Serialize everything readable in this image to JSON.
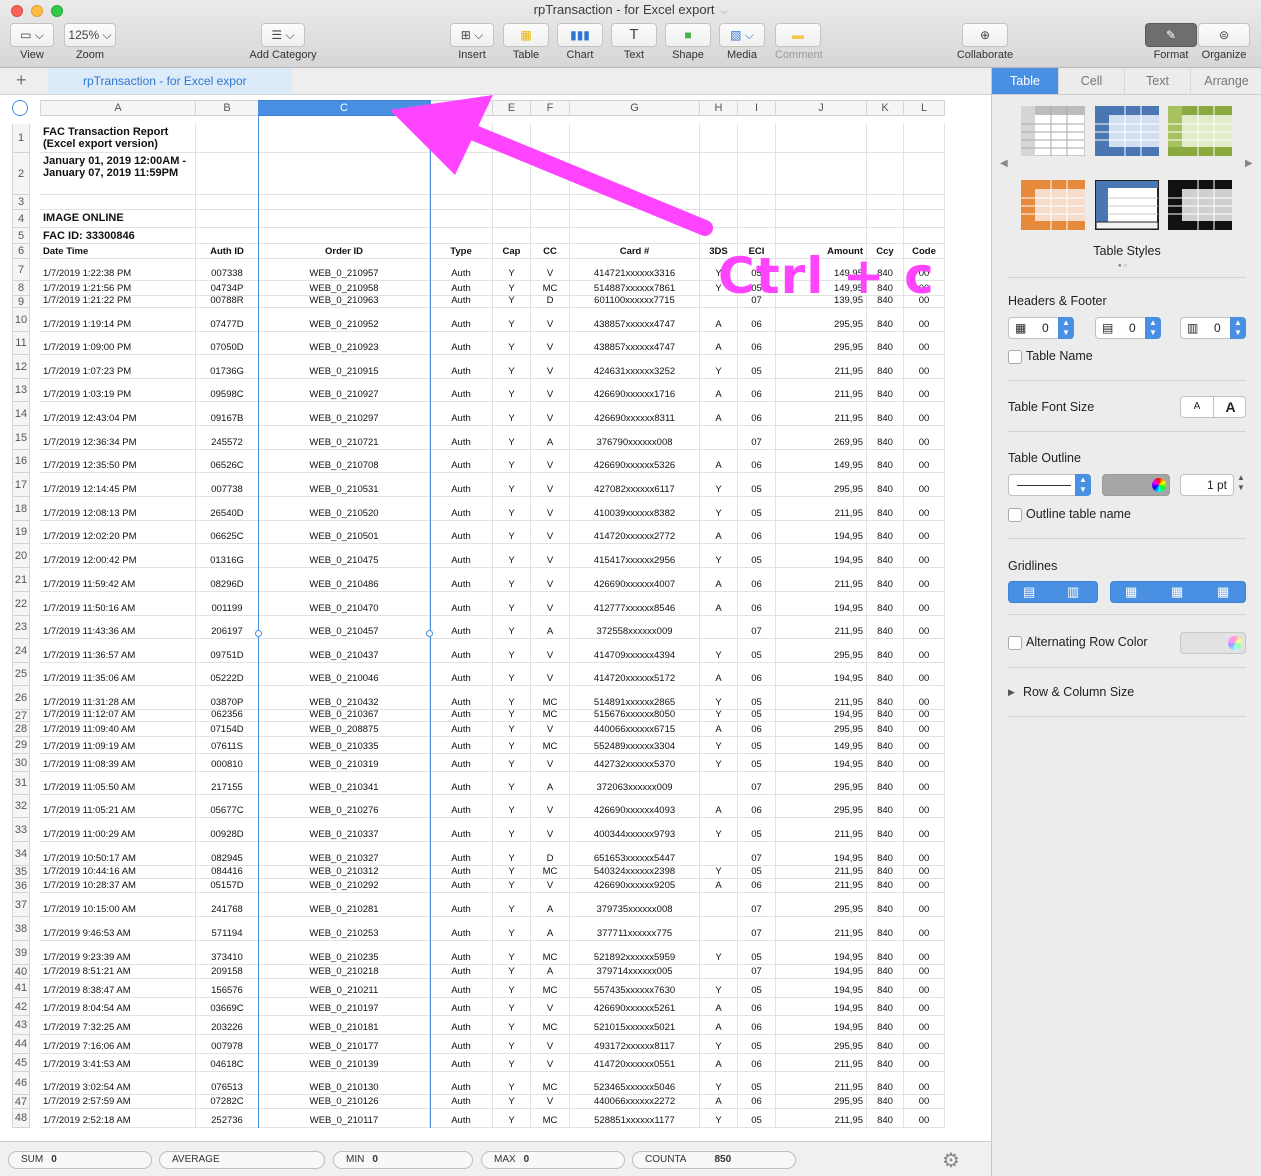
{
  "window": {
    "title": "rpTransaction - for Excel export"
  },
  "toolbar": {
    "view": "View",
    "zoom_value": "125%",
    "zoom": "Zoom",
    "add_category": "Add Category",
    "insert": "Insert",
    "table": "Table",
    "chart": "Chart",
    "text": "Text",
    "shape": "Shape",
    "media": "Media",
    "comment": "Comment",
    "collaborate": "Collaborate",
    "format": "Format",
    "organize": "Organize"
  },
  "sheet": {
    "tab_label": "rpTransaction - for Excel expor",
    "add": "+"
  },
  "columns": [
    "A",
    "B",
    "C",
    "D",
    "E",
    "F",
    "G",
    "H",
    "I",
    "J",
    "K",
    "L"
  ],
  "title_rows": [
    {
      "num": "1",
      "text": "FAC Transaction Report (Excel export version)"
    },
    {
      "num": "2",
      "text": "January 01, 2019 12:00AM - January 07, 2019 11:59PM"
    },
    {
      "num": "3",
      "text": ""
    },
    {
      "num": "4",
      "text": "IMAGE ONLINE"
    },
    {
      "num": "5",
      "text": "FAC ID: 33300846"
    }
  ],
  "header_row": {
    "num": "6",
    "cells": [
      "Date Time",
      "Auth ID",
      "Order ID",
      "Type",
      "Cap",
      "CC",
      "Card #",
      "3DS",
      "ECI",
      "Amount",
      "Ccy",
      "Code"
    ]
  },
  "rows": [
    {
      "num": "7",
      "c": [
        "1/7/2019 1:22:38 PM",
        "007338",
        "WEB_0_210957",
        "Auth",
        "Y",
        "V",
        "414721xxxxxx3316",
        "Y",
        "05",
        "149,95",
        "840",
        "00"
      ]
    },
    {
      "num": "8",
      "c": [
        "1/7/2019 1:21:56 PM",
        "04734P",
        "WEB_0_210958",
        "Auth",
        "Y",
        "MC",
        "514887xxxxxx7861",
        "Y",
        "05",
        "149,95",
        "840",
        "00"
      ]
    },
    {
      "num": "9",
      "c": [
        "1/7/2019 1:21:22 PM",
        "00788R",
        "WEB_0_210963",
        "Auth",
        "Y",
        "D",
        "601100xxxxxx7715",
        "",
        "07",
        "139,95",
        "840",
        "00"
      ]
    },
    {
      "num": "10",
      "c": [
        "1/7/2019 1:19:14 PM",
        "07477D",
        "WEB_0_210952",
        "Auth",
        "Y",
        "V",
        "438857xxxxxx4747",
        "A",
        "06",
        "295,95",
        "840",
        "00"
      ]
    },
    {
      "num": "11",
      "c": [
        "1/7/2019 1:09:00 PM",
        "07050D",
        "WEB_0_210923",
        "Auth",
        "Y",
        "V",
        "438857xxxxxx4747",
        "A",
        "06",
        "295,95",
        "840",
        "00"
      ]
    },
    {
      "num": "12",
      "c": [
        "1/7/2019 1:07:23 PM",
        "01736G",
        "WEB_0_210915",
        "Auth",
        "Y",
        "V",
        "424631xxxxxx3252",
        "Y",
        "05",
        "211,95",
        "840",
        "00"
      ]
    },
    {
      "num": "13",
      "c": [
        "1/7/2019 1:03:19 PM",
        "09598C",
        "WEB_0_210927",
        "Auth",
        "Y",
        "V",
        "426690xxxxxx1716",
        "A",
        "06",
        "211,95",
        "840",
        "00"
      ]
    },
    {
      "num": "14",
      "c": [
        "1/7/2019 12:43:04 PM",
        "09167B",
        "WEB_0_210297",
        "Auth",
        "Y",
        "V",
        "426690xxxxxx8311",
        "A",
        "06",
        "211,95",
        "840",
        "00"
      ]
    },
    {
      "num": "15",
      "c": [
        "1/7/2019 12:36:34 PM",
        "245572",
        "WEB_0_210721",
        "Auth",
        "Y",
        "A",
        "376790xxxxxx008",
        "",
        "07",
        "269,95",
        "840",
        "00"
      ]
    },
    {
      "num": "16",
      "c": [
        "1/7/2019 12:35:50 PM",
        "06526C",
        "WEB_0_210708",
        "Auth",
        "Y",
        "V",
        "426690xxxxxx5326",
        "A",
        "06",
        "149,95",
        "840",
        "00"
      ]
    },
    {
      "num": "17",
      "c": [
        "1/7/2019 12:14:45 PM",
        "007738",
        "WEB_0_210531",
        "Auth",
        "Y",
        "V",
        "427082xxxxxx6117",
        "Y",
        "05",
        "295,95",
        "840",
        "00"
      ]
    },
    {
      "num": "18",
      "c": [
        "1/7/2019 12:08:13 PM",
        "26540D",
        "WEB_0_210520",
        "Auth",
        "Y",
        "V",
        "410039xxxxxx8382",
        "Y",
        "05",
        "211,95",
        "840",
        "00"
      ]
    },
    {
      "num": "19",
      "c": [
        "1/7/2019 12:02:20 PM",
        "06625C",
        "WEB_0_210501",
        "Auth",
        "Y",
        "V",
        "414720xxxxxx2772",
        "A",
        "06",
        "194,95",
        "840",
        "00"
      ]
    },
    {
      "num": "20",
      "c": [
        "1/7/2019 12:00:42 PM",
        "01316G",
        "WEB_0_210475",
        "Auth",
        "Y",
        "V",
        "415417xxxxxx2956",
        "Y",
        "05",
        "194,95",
        "840",
        "00"
      ]
    },
    {
      "num": "21",
      "c": [
        "1/7/2019 11:59:42 AM",
        "08296D",
        "WEB_0_210486",
        "Auth",
        "Y",
        "V",
        "426690xxxxxx4007",
        "A",
        "06",
        "211,95",
        "840",
        "00"
      ]
    },
    {
      "num": "22",
      "c": [
        "1/7/2019 11:50:16 AM",
        "001199",
        "WEB_0_210470",
        "Auth",
        "Y",
        "V",
        "412777xxxxxx8546",
        "A",
        "06",
        "194,95",
        "840",
        "00"
      ]
    },
    {
      "num": "23",
      "c": [
        "1/7/2019 11:43:36 AM",
        "206197",
        "WEB_0_210457",
        "Auth",
        "Y",
        "A",
        "372558xxxxxx009",
        "",
        "07",
        "211,95",
        "840",
        "00"
      ]
    },
    {
      "num": "24",
      "c": [
        "1/7/2019 11:36:57 AM",
        "09751D",
        "WEB_0_210437",
        "Auth",
        "Y",
        "V",
        "414709xxxxxx4394",
        "Y",
        "05",
        "295,95",
        "840",
        "00"
      ]
    },
    {
      "num": "25",
      "c": [
        "1/7/2019 11:35:06 AM",
        "05222D",
        "WEB_0_210046",
        "Auth",
        "Y",
        "V",
        "414720xxxxxx5172",
        "A",
        "06",
        "194,95",
        "840",
        "00"
      ]
    },
    {
      "num": "26",
      "c": [
        "1/7/2019 11:31:28 AM",
        "03870P",
        "WEB_0_210432",
        "Auth",
        "Y",
        "MC",
        "514891xxxxxx2865",
        "Y",
        "05",
        "211,95",
        "840",
        "00"
      ]
    },
    {
      "num": "27",
      "c": [
        "1/7/2019 11:12:07 AM",
        "062356",
        "WEB_0_210367",
        "Auth",
        "Y",
        "MC",
        "515676xxxxxx8050",
        "Y",
        "05",
        "194,95",
        "840",
        "00"
      ]
    },
    {
      "num": "28",
      "c": [
        "1/7/2019 11:09:40 AM",
        "07154D",
        "WEB_0_208875",
        "Auth",
        "Y",
        "V",
        "440066xxxxxx6715",
        "A",
        "06",
        "295,95",
        "840",
        "00"
      ]
    },
    {
      "num": "29",
      "c": [
        "1/7/2019 11:09:19 AM",
        "07611S",
        "WEB_0_210335",
        "Auth",
        "Y",
        "MC",
        "552489xxxxxx3304",
        "Y",
        "05",
        "149,95",
        "840",
        "00"
      ]
    },
    {
      "num": "30",
      "c": [
        "1/7/2019 11:08:39 AM",
        "000810",
        "WEB_0_210319",
        "Auth",
        "Y",
        "V",
        "442732xxxxxx5370",
        "Y",
        "05",
        "194,95",
        "840",
        "00"
      ]
    },
    {
      "num": "31",
      "c": [
        "1/7/2019 11:05:50 AM",
        "217155",
        "WEB_0_210341",
        "Auth",
        "Y",
        "A",
        "372063xxxxxx009",
        "",
        "07",
        "295,95",
        "840",
        "00"
      ]
    },
    {
      "num": "32",
      "c": [
        "1/7/2019 11:05:21 AM",
        "05677C",
        "WEB_0_210276",
        "Auth",
        "Y",
        "V",
        "426690xxxxxx4093",
        "A",
        "06",
        "295,95",
        "840",
        "00"
      ]
    },
    {
      "num": "33",
      "c": [
        "1/7/2019 11:00:29 AM",
        "00928D",
        "WEB_0_210337",
        "Auth",
        "Y",
        "V",
        "400344xxxxxx9793",
        "Y",
        "05",
        "211,95",
        "840",
        "00"
      ]
    },
    {
      "num": "34",
      "c": [
        "1/7/2019 10:50:17 AM",
        "082945",
        "WEB_0_210327",
        "Auth",
        "Y",
        "D",
        "651653xxxxxx5447",
        "",
        "07",
        "194,95",
        "840",
        "00"
      ]
    },
    {
      "num": "35",
      "c": [
        "1/7/2019 10:44:16 AM",
        "084416",
        "WEB_0_210312",
        "Auth",
        "Y",
        "MC",
        "540324xxxxxx2398",
        "Y",
        "05",
        "211,95",
        "840",
        "00"
      ]
    },
    {
      "num": "36",
      "c": [
        "1/7/2019 10:28:37 AM",
        "05157D",
        "WEB_0_210292",
        "Auth",
        "Y",
        "V",
        "426690xxxxxx9205",
        "A",
        "06",
        "211,95",
        "840",
        "00"
      ]
    },
    {
      "num": "37",
      "c": [
        "1/7/2019 10:15:00 AM",
        "241768",
        "WEB_0_210281",
        "Auth",
        "Y",
        "A",
        "379735xxxxxx008",
        "",
        "07",
        "295,95",
        "840",
        "00"
      ]
    },
    {
      "num": "38",
      "c": [
        "1/7/2019 9:46:53 AM",
        "571194",
        "WEB_0_210253",
        "Auth",
        "Y",
        "A",
        "377711xxxxxx775",
        "",
        "07",
        "211,95",
        "840",
        "00"
      ]
    },
    {
      "num": "39",
      "c": [
        "1/7/2019 9:23:39 AM",
        "373410",
        "WEB_0_210235",
        "Auth",
        "Y",
        "MC",
        "521892xxxxxx5959",
        "Y",
        "05",
        "194,95",
        "840",
        "00"
      ]
    },
    {
      "num": "40",
      "c": [
        "1/7/2019 8:51:21 AM",
        "209158",
        "WEB_0_210218",
        "Auth",
        "Y",
        "A",
        "379714xxxxxx005",
        "",
        "07",
        "194,95",
        "840",
        "00"
      ]
    },
    {
      "num": "41",
      "c": [
        "1/7/2019 8:38:47 AM",
        "156576",
        "WEB_0_210211",
        "Auth",
        "Y",
        "MC",
        "557435xxxxxx7630",
        "Y",
        "05",
        "194,95",
        "840",
        "00"
      ]
    },
    {
      "num": "42",
      "c": [
        "1/7/2019 8:04:54 AM",
        "03669C",
        "WEB_0_210197",
        "Auth",
        "Y",
        "V",
        "426690xxxxxx5261",
        "A",
        "06",
        "194,95",
        "840",
        "00"
      ]
    },
    {
      "num": "43",
      "c": [
        "1/7/2019 7:32:25 AM",
        "203226",
        "WEB_0_210181",
        "Auth",
        "Y",
        "MC",
        "521015xxxxxx5021",
        "A",
        "06",
        "194,95",
        "840",
        "00"
      ]
    },
    {
      "num": "44",
      "c": [
        "1/7/2019 7:16:06 AM",
        "007978",
        "WEB_0_210177",
        "Auth",
        "Y",
        "V",
        "493172xxxxxx8117",
        "Y",
        "05",
        "295,95",
        "840",
        "00"
      ]
    },
    {
      "num": "45",
      "c": [
        "1/7/2019 3:41:53 AM",
        "04618C",
        "WEB_0_210139",
        "Auth",
        "Y",
        "V",
        "414720xxxxxx0551",
        "A",
        "06",
        "211,95",
        "840",
        "00"
      ]
    },
    {
      "num": "46",
      "c": [
        "1/7/2019 3:02:54 AM",
        "076513",
        "WEB_0_210130",
        "Auth",
        "Y",
        "MC",
        "523465xxxxxx5046",
        "Y",
        "05",
        "211,95",
        "840",
        "00"
      ]
    },
    {
      "num": "47",
      "c": [
        "1/7/2019 2:57:59 AM",
        "07282C",
        "WEB_0_210126",
        "Auth",
        "Y",
        "V",
        "440066xxxxxx2272",
        "A",
        "06",
        "295,95",
        "840",
        "00"
      ]
    },
    {
      "num": "48",
      "c": [
        "1/7/2019 2:52:18 AM",
        "252736",
        "WEB_0_210117",
        "Auth",
        "Y",
        "MC",
        "528851xxxxxx1177",
        "Y",
        "05",
        "211,95",
        "840",
        "00"
      ]
    }
  ],
  "annotation": {
    "text": "Ctrl + c",
    "color": "#ff44ff"
  },
  "status": {
    "sum_label": "SUM",
    "sum_value": "0",
    "average_label": "AVERAGE",
    "min_label": "MIN",
    "min_value": "0",
    "max_label": "MAX",
    "max_value": "0",
    "counta_label": "COUNTA",
    "counta_value": "850"
  },
  "inspector": {
    "tabs": [
      "Table",
      "Cell",
      "Text",
      "Arrange"
    ],
    "table_styles": "Table Styles",
    "headers_footer": "Headers & Footer",
    "header_rows": "0",
    "header_cols": "0",
    "footer_rows": "0",
    "table_name": "Table Name",
    "table_font_size": "Table Font Size",
    "font_small": "A",
    "font_large": "A",
    "table_outline": "Table Outline",
    "outline_pt": "1 pt",
    "outline_table_name": "Outline table name",
    "gridlines": "Gridlines",
    "alternating_row_color": "Alternating Row Color",
    "row_column_size": "Row & Column Size"
  }
}
